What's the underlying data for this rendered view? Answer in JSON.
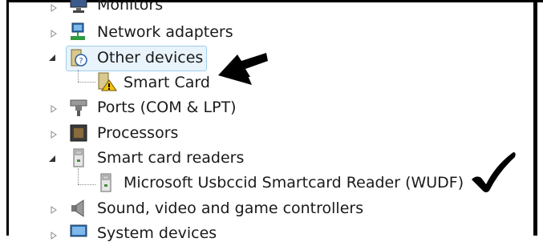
{
  "tree": {
    "items": [
      {
        "label": "Monitors",
        "icon": "monitor-icon",
        "state": "collapsed"
      },
      {
        "label": "Network adapters",
        "icon": "network-adapter-icon",
        "state": "collapsed"
      },
      {
        "label": "Other devices",
        "icon": "unknown-device-icon",
        "state": "expanded",
        "selected": true
      },
      {
        "label": "Smart Card",
        "icon": "warning-device-icon",
        "state": "leaf"
      },
      {
        "label": "Ports (COM & LPT)",
        "icon": "port-icon",
        "state": "collapsed"
      },
      {
        "label": "Processors",
        "icon": "processor-icon",
        "state": "collapsed"
      },
      {
        "label": "Smart card readers",
        "icon": "smart-card-reader-icon",
        "state": "expanded"
      },
      {
        "label": "Microsoft Usbccid Smartcard Reader (WUDF)",
        "icon": "smart-card-reader-icon",
        "state": "leaf"
      },
      {
        "label": "Sound, video and game controllers",
        "icon": "speaker-icon",
        "state": "collapsed"
      },
      {
        "label": "System devices",
        "icon": "system-device-icon",
        "state": "collapsed"
      }
    ]
  },
  "annotations": {
    "arrow_icon": "arrow-left-icon",
    "check_icon": "checkmark-icon"
  },
  "colors": {
    "selection_bg": "#e8f3fb",
    "selection_border": "#9fcfee",
    "warning_yellow": "#f4c20d"
  }
}
